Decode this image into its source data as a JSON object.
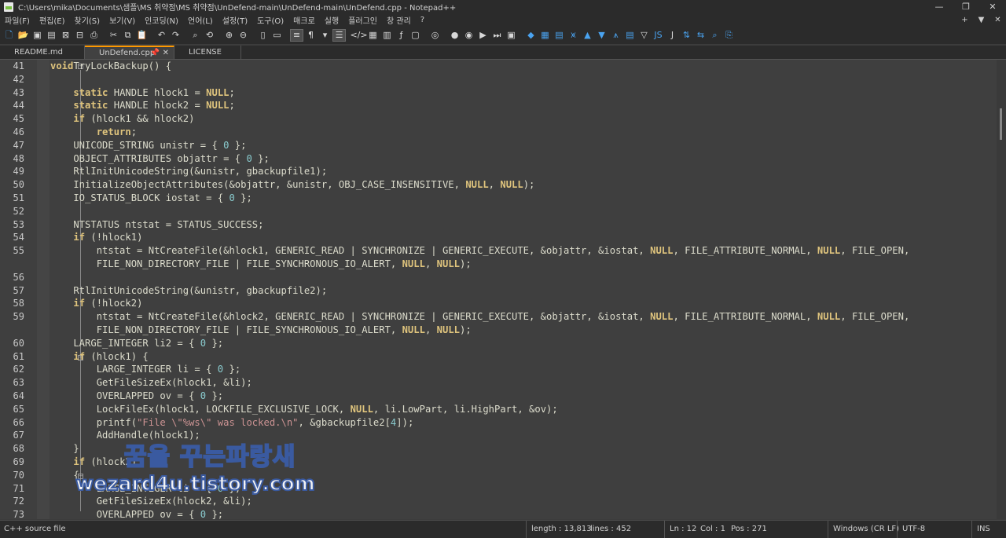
{
  "window": {
    "title": "C:\\Users\\mika\\Documents\\샘플\\MS 취약점\\MS 취약점\\UnDefend-main\\UnDefend-main\\UnDefend.cpp - Notepad++",
    "minimize": "—",
    "maximize": "❐",
    "close": "✕"
  },
  "menu": {
    "items": [
      "파일(F)",
      "편집(E)",
      "찾기(S)",
      "보기(V)",
      "인코딩(N)",
      "언어(L)",
      "설정(T)",
      "도구(O)",
      "매크로",
      "실행",
      "플러그인",
      "창 관리",
      "?"
    ],
    "right": [
      "+",
      "▼",
      "✕"
    ]
  },
  "toolbar": {
    "icons": [
      "new-file",
      "open-file",
      "save",
      "save-all",
      "close",
      "close-all",
      "print",
      "sep",
      "cut",
      "copy",
      "paste",
      "sep",
      "undo",
      "redo",
      "sep",
      "find",
      "replace",
      "sep",
      "zoom-in",
      "zoom-out",
      "sep",
      "sync-v",
      "sync-h",
      "sep",
      "word-wrap",
      "show-all-chars",
      "indent-guide",
      "sep",
      "doc-map",
      "function-list",
      "folder-as-workspace",
      "sep",
      "record-macro",
      "stop-macro",
      "play-macro",
      "run-macro-multiple",
      "save-macro",
      "sep",
      "b1",
      "b2",
      "b3",
      "b4",
      "b5",
      "b6",
      "b7",
      "b8",
      "b9",
      "b10",
      "b11",
      "b12",
      "b13",
      "b14"
    ]
  },
  "tabs": [
    {
      "label": "README.md",
      "active": false
    },
    {
      "label": "UnDefend.cpp",
      "active": true
    },
    {
      "label": "LICENSE",
      "active": false
    }
  ],
  "editor": {
    "lines": [
      {
        "n": "41",
        "t": [
          [
            "kw",
            "void"
          ],
          [
            "",
            "TryLockBackup() {"
          ]
        ]
      },
      {
        "n": "42",
        "t": []
      },
      {
        "n": "43",
        "t": [
          [
            "",
            "    "
          ],
          [
            "kw",
            "static"
          ],
          [
            "",
            " HANDLE hlock1 = "
          ],
          [
            "nl",
            "NULL"
          ],
          [
            "",
            ";"
          ]
        ]
      },
      {
        "n": "44",
        "t": [
          [
            "",
            "    "
          ],
          [
            "kw",
            "static"
          ],
          [
            "",
            " HANDLE hlock2 = "
          ],
          [
            "nl",
            "NULL"
          ],
          [
            "",
            ";"
          ]
        ]
      },
      {
        "n": "45",
        "t": [
          [
            "",
            "    "
          ],
          [
            "kw",
            "if"
          ],
          [
            "",
            " (hlock1 && hlock2)"
          ]
        ]
      },
      {
        "n": "46",
        "t": [
          [
            "",
            "        "
          ],
          [
            "kw",
            "return"
          ],
          [
            "",
            ";"
          ]
        ]
      },
      {
        "n": "47",
        "t": [
          [
            "",
            "    UNICODE_STRING unistr = { "
          ],
          [
            "num",
            "0"
          ],
          [
            "",
            " };"
          ]
        ]
      },
      {
        "n": "48",
        "t": [
          [
            "",
            "    OBJECT_ATTRIBUTES objattr = { "
          ],
          [
            "num",
            "0"
          ],
          [
            "",
            " };"
          ]
        ]
      },
      {
        "n": "49",
        "t": [
          [
            "",
            "    RtlInitUnicodeString(&unistr, gbackupfile1);"
          ]
        ]
      },
      {
        "n": "50",
        "t": [
          [
            "",
            "    InitializeObjectAttributes(&objattr, &unistr, OBJ_CASE_INSENSITIVE, "
          ],
          [
            "nl",
            "NULL"
          ],
          [
            "",
            ", "
          ],
          [
            "nl",
            "NULL"
          ],
          [
            "",
            ");"
          ]
        ]
      },
      {
        "n": "51",
        "t": [
          [
            "",
            "    IO_STATUS_BLOCK iostat = { "
          ],
          [
            "num",
            "0"
          ],
          [
            "",
            " };"
          ]
        ]
      },
      {
        "n": "52",
        "t": []
      },
      {
        "n": "53",
        "t": [
          [
            "",
            "    NTSTATUS ntstat = STATUS_SUCCESS;"
          ]
        ]
      },
      {
        "n": "54",
        "t": [
          [
            "",
            "    "
          ],
          [
            "kw",
            "if"
          ],
          [
            "",
            " (!hlock1)"
          ]
        ]
      },
      {
        "n": "55",
        "t": [
          [
            "",
            "        ntstat = NtCreateFile(&hlock1, GENERIC_READ | SYNCHRONIZE | GENERIC_EXECUTE, &objattr, &iostat, "
          ],
          [
            "nl",
            "NULL"
          ],
          [
            "",
            ", FILE_ATTRIBUTE_NORMAL, "
          ],
          [
            "nl",
            "NULL"
          ],
          [
            "",
            ", FILE_OPEN,"
          ]
        ]
      },
      {
        "n": "",
        "t": [
          [
            "",
            "        FILE_NON_DIRECTORY_FILE | FILE_SYNCHRONOUS_IO_ALERT, "
          ],
          [
            "nl",
            "NULL"
          ],
          [
            "",
            ", "
          ],
          [
            "nl",
            "NULL"
          ],
          [
            "",
            ");"
          ]
        ]
      },
      {
        "n": "56",
        "t": []
      },
      {
        "n": "57",
        "t": [
          [
            "",
            "    RtlInitUnicodeString(&unistr, gbackupfile2);"
          ]
        ]
      },
      {
        "n": "58",
        "t": [
          [
            "",
            "    "
          ],
          [
            "kw",
            "if"
          ],
          [
            "",
            " (!hlock2)"
          ]
        ]
      },
      {
        "n": "59",
        "t": [
          [
            "",
            "        ntstat = NtCreateFile(&hlock2, GENERIC_READ | SYNCHRONIZE | GENERIC_EXECUTE, &objattr, &iostat, "
          ],
          [
            "nl",
            "NULL"
          ],
          [
            "",
            ", FILE_ATTRIBUTE_NORMAL, "
          ],
          [
            "nl",
            "NULL"
          ],
          [
            "",
            ", FILE_OPEN,"
          ]
        ]
      },
      {
        "n": "",
        "t": [
          [
            "",
            "        FILE_NON_DIRECTORY_FILE | FILE_SYNCHRONOUS_IO_ALERT, "
          ],
          [
            "nl",
            "NULL"
          ],
          [
            "",
            ", "
          ],
          [
            "nl",
            "NULL"
          ],
          [
            "",
            ");"
          ]
        ]
      },
      {
        "n": "60",
        "t": [
          [
            "",
            "    LARGE_INTEGER li2 = { "
          ],
          [
            "num",
            "0"
          ],
          [
            "",
            " };"
          ]
        ]
      },
      {
        "n": "61",
        "t": [
          [
            "",
            "    "
          ],
          [
            "kw",
            "if"
          ],
          [
            "",
            " (hlock1) {"
          ]
        ]
      },
      {
        "n": "62",
        "t": [
          [
            "",
            "        LARGE_INTEGER li = { "
          ],
          [
            "num",
            "0"
          ],
          [
            "",
            " };"
          ]
        ]
      },
      {
        "n": "63",
        "t": [
          [
            "",
            "        GetFileSizeEx(hlock1, &li);"
          ]
        ]
      },
      {
        "n": "64",
        "t": [
          [
            "",
            "        OVERLAPPED ov = { "
          ],
          [
            "num",
            "0"
          ],
          [
            "",
            " };"
          ]
        ]
      },
      {
        "n": "65",
        "t": [
          [
            "",
            "        LockFileEx(hlock1, LOCKFILE_EXCLUSIVE_LOCK, "
          ],
          [
            "nl",
            "NULL"
          ],
          [
            "",
            ", li.LowPart, li.HighPart, &ov);"
          ]
        ]
      },
      {
        "n": "66",
        "t": [
          [
            "",
            "        printf("
          ],
          [
            "str",
            "\"File \\\"%ws\\\" was locked.\\n\""
          ],
          [
            "",
            ", &gbackupfile2["
          ],
          [
            "num",
            "4"
          ],
          [
            "",
            "]);"
          ]
        ]
      },
      {
        "n": "67",
        "t": [
          [
            "",
            "        AddHandle(hlock1);"
          ]
        ]
      },
      {
        "n": "68",
        "t": [
          [
            "",
            "    }"
          ]
        ]
      },
      {
        "n": "69",
        "t": [
          [
            "",
            "    "
          ],
          [
            "kw",
            "if"
          ],
          [
            "",
            " (hlock2)"
          ]
        ]
      },
      {
        "n": "70",
        "t": [
          [
            "",
            "    {"
          ]
        ]
      },
      {
        "n": "71",
        "t": [
          [
            "",
            "        LARGE_INTEGER li = { "
          ],
          [
            "num",
            "0"
          ],
          [
            "",
            " };"
          ]
        ]
      },
      {
        "n": "72",
        "t": [
          [
            "",
            "        GetFileSizeEx(hlock2, &li);"
          ]
        ]
      },
      {
        "n": "73",
        "t": [
          [
            "",
            "        OVERLAPPED ov = { "
          ],
          [
            "num",
            "0"
          ],
          [
            "",
            " };"
          ]
        ]
      }
    ]
  },
  "watermark": {
    "line1": "꿈을 꾸는파랑새",
    "line2": "wezard4u.tistory.com"
  },
  "status": {
    "lang": "C++ source file",
    "length": "length : 13,813",
    "lines": "lines : 452",
    "ln": "Ln : 12",
    "col": "Col : 1",
    "pos": "Pos : 271",
    "eol": "Windows (CR LF)",
    "enc": "UTF-8",
    "ins": "INS"
  }
}
